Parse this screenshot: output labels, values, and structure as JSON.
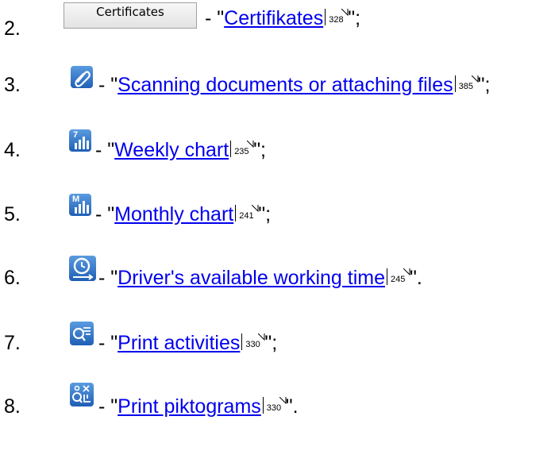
{
  "items": [
    {
      "number": "2.",
      "button_label": "Certificates",
      "prefix": " - \"",
      "link": "Certifikates",
      "page": "328",
      "suffix": "\";",
      "icon": "certificates-button"
    },
    {
      "number": "3.",
      "prefix": " - \"",
      "link": "Scanning documents or attaching files",
      "page": "385",
      "suffix": "\";",
      "icon": "paperclip-icon"
    },
    {
      "number": "4.",
      "prefix": " - \"",
      "link": "Weekly chart",
      "page": "235",
      "suffix": "\";",
      "icon": "weekly-chart-icon"
    },
    {
      "number": "5.",
      "prefix": " - \"",
      "link": "Monthly chart",
      "page": "241",
      "suffix": "\";",
      "icon": "monthly-chart-icon"
    },
    {
      "number": "6.",
      "prefix": " - \"",
      "link": "Driver's available working time",
      "page": "245",
      "suffix": "\".",
      "icon": "clock-icon"
    },
    {
      "number": "7.",
      "prefix": " - \"",
      "link": "Print activities",
      "page": "330",
      "suffix": "\";",
      "icon": "print-activities-icon"
    },
    {
      "number": "8.",
      "prefix": " - \"",
      "link": "Print piktograms",
      "page": "330",
      "suffix": "\".",
      "icon": "print-piktograms-icon"
    }
  ],
  "icon_labels": {
    "weekly": "7",
    "monthly": "M"
  },
  "colors": {
    "link": "#0000ee",
    "icon_blue": "#2a6cc4"
  }
}
